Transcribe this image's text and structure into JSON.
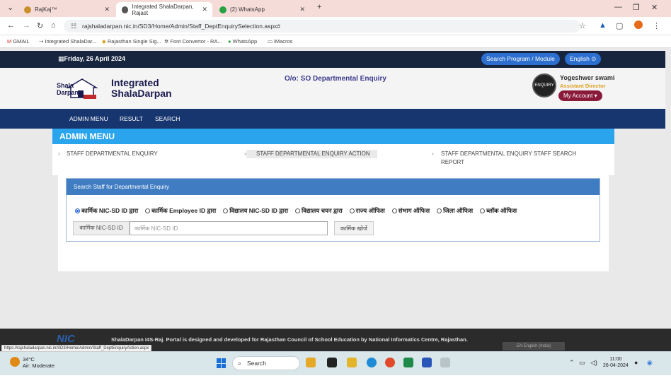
{
  "browser": {
    "tabs": [
      {
        "label": "RajKaj™",
        "active": false
      },
      {
        "label": "Integrated ShalaDarpan, Rajast",
        "active": true
      },
      {
        "label": "(2) WhatsApp",
        "active": false
      }
    ],
    "new_tab": "+",
    "url": "rajshaladarpan.nic.in/SD3/Home/Admin/Staff_DeptEnquirySelection.aspx#",
    "bookmarks": [
      "GMAIL",
      "Integrated ShalaDar...",
      "Rajasthan Single Sig...",
      "Font Convertor - RA...",
      "WhatsApp",
      "iMacros"
    ],
    "status_url": "https://rajshaladarpan.nic.in/SD3/Home/Admin/Staff_DeptEnquiryAction.aspx"
  },
  "topbar": {
    "date": "Friday, 26 April 2024",
    "search_program": "Search Program / Module",
    "language": "English"
  },
  "header": {
    "logo_text_1": "Shala",
    "logo_text_2": "Darpan",
    "title_line1": "Integrated",
    "title_line2": "ShalaDarpan",
    "office": "O/o: SO Departmental Enquiry",
    "user_logo_text": "ENQUIRY",
    "user_name": "Yogeshwer swami",
    "user_role": "Assistant Director",
    "my_account": "My Account"
  },
  "nav": {
    "items": [
      "ADMIN MENU",
      "RESULT",
      "SEARCH"
    ]
  },
  "admin_menu": {
    "title": "ADMIN MENU",
    "links": [
      {
        "label": "STAFF DEPARTMENTAL ENQUIRY"
      },
      {
        "label": "STAFF DEPARTMENTAL ENQUIRY ACTION"
      },
      {
        "label": "STAFF DEPARTMENTAL ENQUIRY STAFF SEARCH REPORT"
      }
    ]
  },
  "search_panel": {
    "title": "Search Staff for Departmental Enquiry",
    "options": [
      {
        "label": "कार्मिक NIC-SD ID द्वारा",
        "selected": true
      },
      {
        "label": "कार्मिक Employee ID द्वारा",
        "selected": false
      },
      {
        "label": "विद्यालय NIC-SD ID द्वारा",
        "selected": false
      },
      {
        "label": "विद्यालय चयन द्वारा",
        "selected": false
      },
      {
        "label": "राज्य ऑफिस",
        "selected": false
      },
      {
        "label": "संभाग ऑफिस",
        "selected": false
      },
      {
        "label": "जिला ऑफिस",
        "selected": false
      },
      {
        "label": "ब्लॉक ऑफिस",
        "selected": false
      }
    ],
    "input_label": "कार्मिक NIC-SD ID",
    "input_placeholder": "कार्मिक NIC-SD ID",
    "input_value": "",
    "search_button": "कार्मिक खोजें"
  },
  "footer": {
    "logo": "NIC",
    "text": "ShalaDarpan I4S-Raj. Portal is designed and developed for Rajasthan Council of School Education by National Informatics Centre, Rajasthan.",
    "language_select": "EN English (India)"
  },
  "taskbar": {
    "weather_temp": "34°C",
    "weather_desc": "Air: Moderate",
    "search": "Search",
    "time": "11:00",
    "date": "26-04-2024"
  },
  "colors": {
    "topstrip": "#17253f",
    "nav": "#17356e",
    "admin_head": "#2aa4ec",
    "panel_head": "#3f7cc2",
    "my_account": "#8a1a3a"
  }
}
